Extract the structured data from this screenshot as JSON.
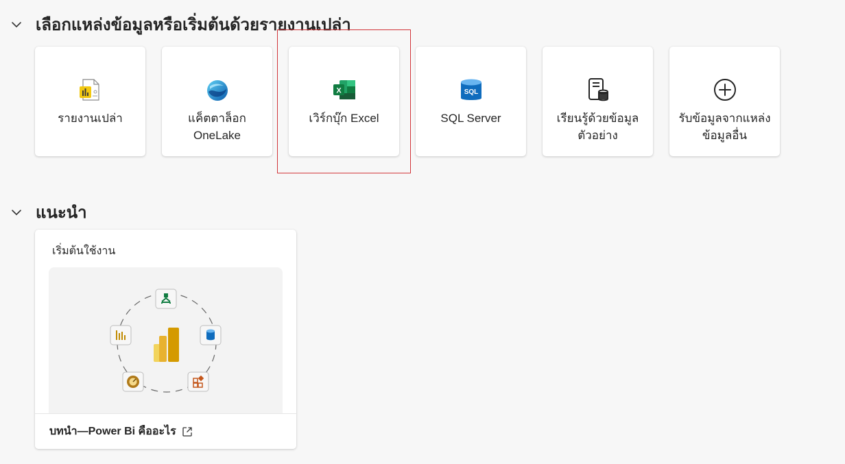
{
  "sections": {
    "data_source": {
      "title": "เลือกแหล่งข้อมูลหรือเริ่มต้นด้วยรายงานเปล่า"
    },
    "recommended": {
      "title": "แนะนำ"
    }
  },
  "cards": [
    {
      "label": "รายงานเปล่า",
      "icon": "blank-report-icon"
    },
    {
      "label": "แค็ตตาล็อก OneLake",
      "icon": "onelake-icon"
    },
    {
      "label": "เวิร์กบุ๊ก Excel",
      "icon": "excel-icon"
    },
    {
      "label": "SQL Server",
      "icon": "sql-server-icon",
      "icon_text": "SQL"
    },
    {
      "label": "เรียนรู้ด้วยข้อมูลตัวอย่าง",
      "icon": "sample-data-icon"
    },
    {
      "label": "รับข้อมูลจากแหล่งข้อมูลอื่น",
      "icon": "add-circle-icon"
    }
  ],
  "recommended_card": {
    "tag": "เริ่มต้นใช้งาน",
    "title": "บทนำ—Power Bi คืออะไร",
    "icon": "open-external-icon"
  },
  "colors": {
    "excel_green": "#107c41",
    "sql_blue": "#0f6cbd",
    "powerbi_yellow": "#f2c811",
    "highlight_red": "#d13438"
  }
}
